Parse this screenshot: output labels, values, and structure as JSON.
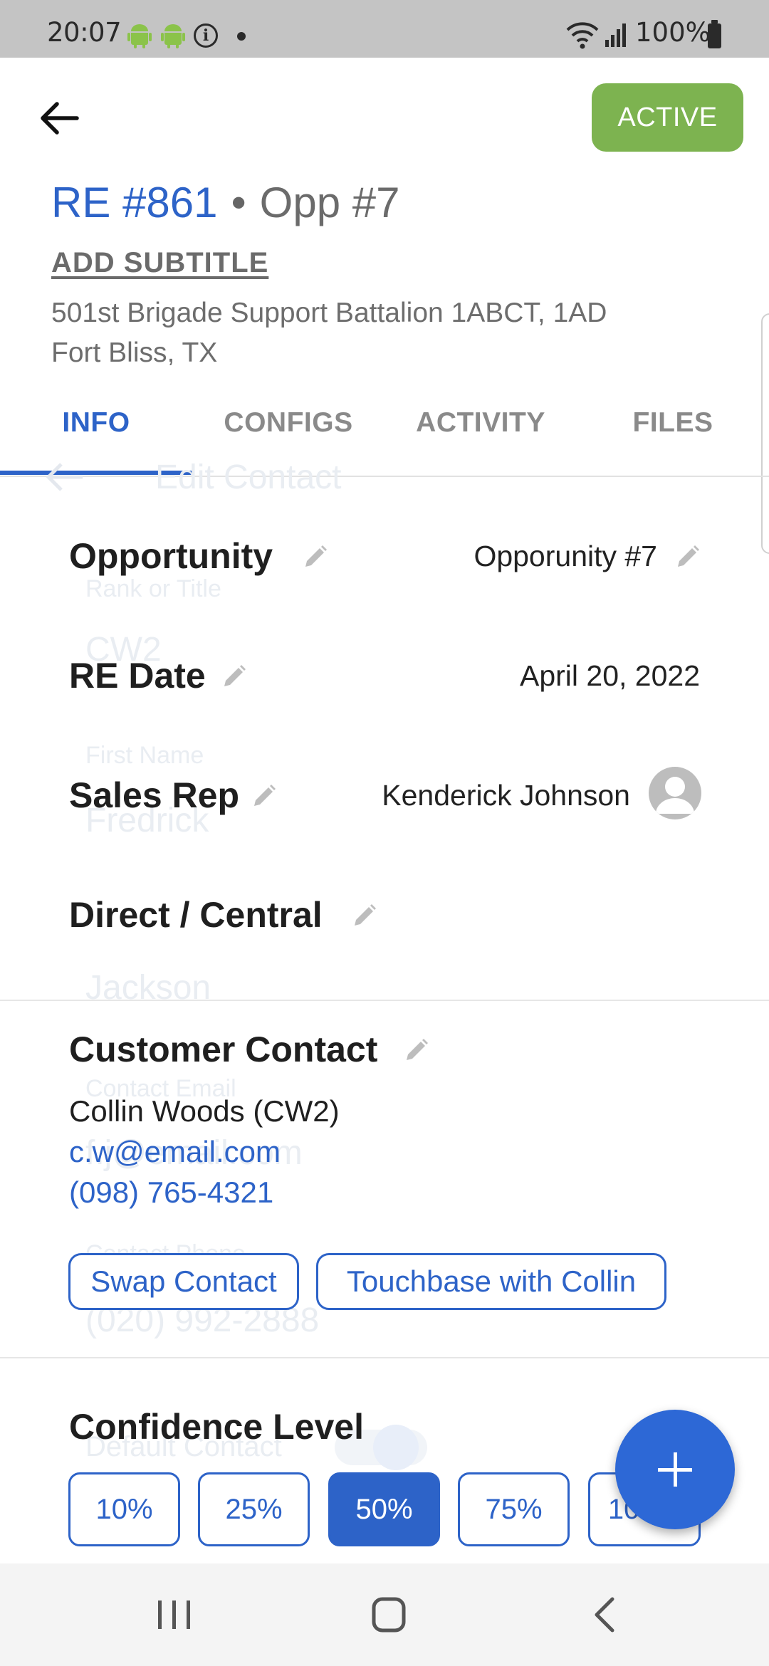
{
  "status_bar": {
    "time": "20:07",
    "battery": "100%",
    "icons": [
      "android-icon",
      "android-icon",
      "info-icon",
      "notification-dot-icon",
      "wifi-icon",
      "signal-icon",
      "battery-icon"
    ]
  },
  "header": {
    "back_icon": "arrow-left-icon",
    "status_badge": "ACTIVE",
    "re_number": "RE #861",
    "separator": "•",
    "opp_number": "Opp #7",
    "add_subtitle": "ADD SUBTITLE",
    "unit_line1": "501st Brigade Support Battalion 1ABCT, 1AD",
    "unit_line2": "Fort Bliss, TX"
  },
  "tabs": [
    {
      "label": "INFO",
      "active": true
    },
    {
      "label": "CONFIGS",
      "active": false
    },
    {
      "label": "ACTIVITY",
      "active": false
    },
    {
      "label": "FILES",
      "active": false
    }
  ],
  "ghost_overlay": {
    "title": "Edit Contact",
    "rank_label": "Rank or Title",
    "rank_value": "CW2",
    "first_name_label": "First Name",
    "first_name_value": "Fredrick",
    "last_name_value": "Jackson",
    "email_label": "Contact Email",
    "email_value": "f.j@email.com",
    "phone_label": "Contact Phone",
    "phone_value": "(020) 992-2888",
    "default_label": "Default Contact"
  },
  "info": {
    "opportunity_label": "Opportunity",
    "opportunity_value": "Opporunity #7",
    "re_date_label": "RE Date",
    "re_date_value": "April 20, 2022",
    "sales_rep_label": "Sales Rep",
    "sales_rep_value": "Kenderick Johnson",
    "direct_central_label": "Direct / Central"
  },
  "customer_contact": {
    "label": "Customer Contact",
    "name": "Collin Woods (CW2)",
    "email": "c.w@email.com",
    "phone": "(098) 765-4321",
    "swap_button": "Swap Contact",
    "touchbase_button": "Touchbase with Collin"
  },
  "confidence": {
    "label": "Confidence Level",
    "options": [
      "10%",
      "25%",
      "50%",
      "75%",
      "100%"
    ],
    "selected": "50%"
  },
  "fab": {
    "icon": "plus-icon"
  },
  "nav_bar": {
    "icons": [
      "recent-apps-icon",
      "home-icon",
      "back-icon"
    ]
  },
  "colors": {
    "accent": "#2d63c8",
    "active_badge": "#7db350",
    "status_bar": "#c4c4c4"
  }
}
